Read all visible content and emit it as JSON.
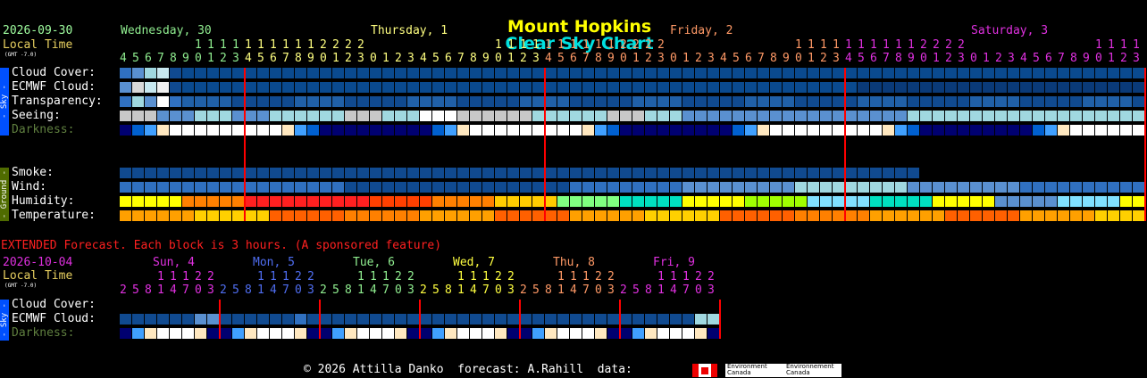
{
  "chart_data": {
    "type": "heatmap",
    "title": "Mount Hopkins Clear Sky Chart",
    "title_parts": [
      "Mount Hopkins",
      "Clear Sky Chart"
    ],
    "header": {
      "date": "2026-09-30",
      "local_time": "Local Time",
      "gmt": "(GMT -7.0)",
      "days": [
        "Wednesday, 30",
        "Thursday, 1",
        "Friday, 2",
        "Saturday, 3"
      ],
      "hours_text": "456789012301234567890123012345678901230123456789012301234567890123012345678901230123456789012301234567890123012345678901230",
      "hours_tens": "1111111222200000000001111111111222200000000001111111111222200000000001111111111222200000000001111111111222200000000001111111111222200000"
    },
    "sky_rows": [
      "Cloud Cover:",
      "ECMWF Cloud:",
      "Transparency:",
      "Seeing:",
      "Darkness:"
    ],
    "ground_rows": [
      "Smoke:",
      "Wind:",
      "Humidity:",
      "Temperature:"
    ],
    "side_labels": {
      "sky": "- Sky -",
      "ground": "- Ground -"
    },
    "extended": {
      "note": "EXTENDED Forecast. Each block is 3 hours. (A sponsored feature)",
      "date": "2026-10-04",
      "local_time": "Local Time",
      "gmt": "(GMT -7.0)",
      "days": [
        "Sun, 4",
        "Mon, 5",
        "Tue, 6",
        "Wed, 7",
        "Thu, 8",
        "Fri, 9"
      ],
      "day_tens": "11122",
      "day_hours": "25814703",
      "rows": [
        "Cloud Cover:",
        "ECMWF Cloud:",
        "Darkness:"
      ],
      "side_label": "- Sky -"
    },
    "footer": "© 2026 Attilla Danko  forecast: A.Rahill  data:",
    "data_logo": [
      "Environment",
      "Canada",
      "Environnement",
      "Canada"
    ],
    "colors": {
      "title1": "#ffff00",
      "title2": "#00e0e0",
      "wed": "#90ee90",
      "thu": "#ffff80",
      "fri": "#ff9966",
      "sat": "#e030e0",
      "sun": "#e030e0",
      "mon": "#4f6df0",
      "tue": "#90ee90",
      "wed2": "#ffff40",
      "thu2": "#ff9966",
      "fri2": "#e030e0",
      "date": "#a0ffa0",
      "local": "#e8d060",
      "extended": "#ff2020",
      "midnight": "#ff0000",
      "side_sky": "#0050ff",
      "side_ground": "#4f6b00",
      "darkness_label": "#5f7f3f"
    }
  }
}
